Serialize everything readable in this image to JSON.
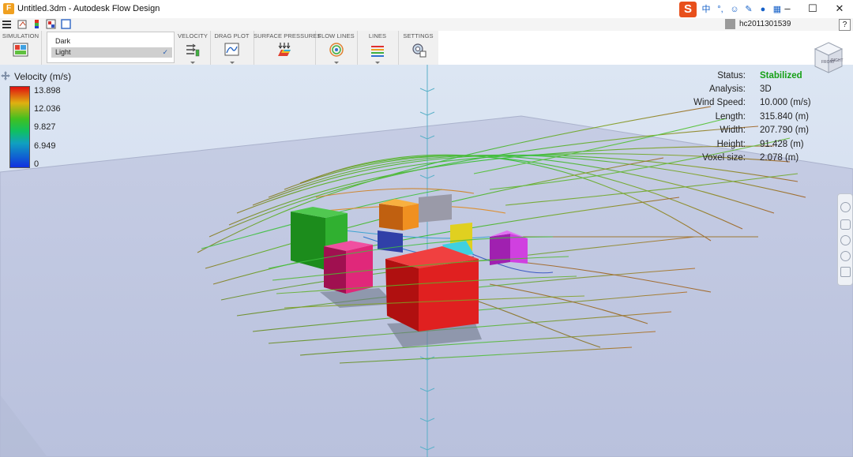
{
  "window": {
    "title": "Untitled.3dm - Autodesk Flow Design",
    "app_icon": "F",
    "controls": [
      "–",
      "☐",
      "✕"
    ]
  },
  "ime_toolbar": {
    "logo": "S",
    "chars": "中",
    "icons": [
      "punctuation-icon",
      "emoji-icon",
      "pen-icon",
      "microphone-icon",
      "grid-icon"
    ]
  },
  "user": {
    "name": "hc2011301539",
    "help": "?"
  },
  "ribbon": {
    "groups": [
      {
        "label": "SIMULATION",
        "icon": "simulation-icon"
      },
      {
        "label": "VELOCITY",
        "icon": "velocity-icon"
      },
      {
        "label": "DRAG PLOT",
        "icon": "drag-plot-icon"
      },
      {
        "label": "SURFACE PRESSURES",
        "icon": "surface-pressures-icon"
      },
      {
        "label": "FLOW LINES",
        "icon": "flow-lines-icon"
      },
      {
        "label": "LINES",
        "icon": "lines-icon"
      },
      {
        "label": "SETTINGS",
        "icon": "settings-icon"
      }
    ]
  },
  "theme_menu": {
    "options": [
      {
        "label": "Dark",
        "selected": false
      },
      {
        "label": "Light",
        "selected": true
      }
    ],
    "check": "✓"
  },
  "legend": {
    "title": "Velocity (m/s)",
    "values": [
      "13.898",
      "12.036",
      "9.827",
      "6.949",
      "0"
    ]
  },
  "info": {
    "rows": [
      {
        "label": "Status:",
        "value": "Stabilized",
        "color": "#16a016"
      },
      {
        "label": "Analysis:",
        "value": "3D"
      },
      {
        "label": "Wind Speed:",
        "value": "10.000 (m/s)"
      },
      {
        "label": "Length:",
        "value": "315.840 (m)"
      },
      {
        "label": "Width:",
        "value": "207.790 (m)"
      },
      {
        "label": "Height:",
        "value": "91.428 (m)"
      },
      {
        "label": "Voxel size:",
        "value": "2.078 (m)"
      }
    ]
  },
  "viewcube": {
    "front": "FRONT",
    "right": "RIGHT"
  },
  "colors": {
    "accent": "#e8501c",
    "status_ok": "#16a016",
    "ground": "#c3cbe3"
  }
}
